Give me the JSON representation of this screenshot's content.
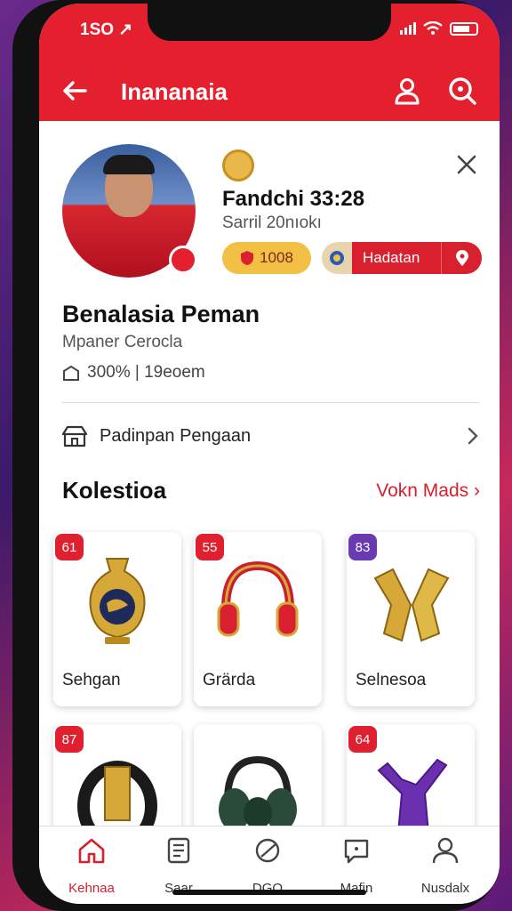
{
  "status": {
    "time": "1SO ↗"
  },
  "header": {
    "title": "Inananaia"
  },
  "profile": {
    "name": "Fandchi 33:28",
    "subtitle": "Sarril 20nıokı",
    "badge_gold": "1008",
    "badge_red": "Hadatan",
    "full_name": "Benalasia Peman",
    "role": "Mpaner Cerocla",
    "stat": "300% | 19eoem"
  },
  "link_row": {
    "label": "Padinpan Pengaan"
  },
  "collection": {
    "title": "Kolestioa",
    "view_all": "Vokn Mads ›",
    "items": [
      {
        "tag": "61",
        "tag_color": "#e0202e",
        "name": "Sehgan"
      },
      {
        "tag": "55",
        "tag_color": "#e0202e",
        "name": "Grärda"
      },
      {
        "tag": "83",
        "tag_color": "#6a3ab0",
        "name": "Selnesoa"
      },
      {
        "tag": "87",
        "tag_color": "#e0202e",
        "name": ""
      },
      {
        "tag": "",
        "tag_color": "#ffffff",
        "name": ""
      },
      {
        "tag": "64",
        "tag_color": "#e0202e",
        "name": ""
      }
    ]
  },
  "nav": {
    "items": [
      {
        "label": "Kehnaa",
        "icon": "home-icon",
        "active": true
      },
      {
        "label": "Saar",
        "icon": "list-icon",
        "active": false
      },
      {
        "label": "DGO",
        "icon": "leaf-icon",
        "active": false
      },
      {
        "label": "Mafin",
        "icon": "chat-icon",
        "active": false
      },
      {
        "label": "Nusdalx",
        "icon": "person-icon",
        "active": false
      }
    ]
  },
  "colors": {
    "accent": "#e4202e",
    "gold": "#f2c044",
    "purple": "#6a3ab0"
  }
}
